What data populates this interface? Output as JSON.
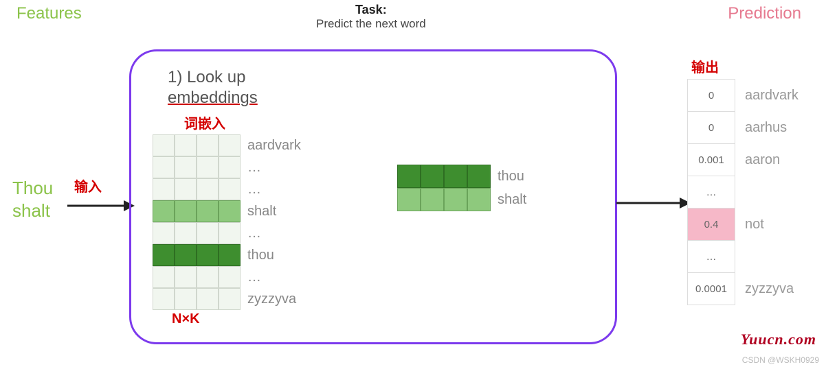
{
  "header": {
    "features": "Features",
    "task_title": "Task:",
    "task_sub": "Predict the next word",
    "prediction": "Prediction"
  },
  "input": {
    "line1": "Thou",
    "line2": "shalt",
    "anno": "输入"
  },
  "step1": {
    "line1": "1) Look up",
    "line2": "embeddings",
    "anno": "词嵌入",
    "nk": "N×K"
  },
  "emb_rows": [
    {
      "label": "aardvark",
      "style": "plain"
    },
    {
      "label": "…",
      "style": "plain"
    },
    {
      "label": "…",
      "style": "plain"
    },
    {
      "label": "shalt",
      "style": "shalt"
    },
    {
      "label": "…",
      "style": "plain"
    },
    {
      "label": "thou",
      "style": "thou"
    },
    {
      "label": "…",
      "style": "plain"
    },
    {
      "label": "zyzzyva",
      "style": "plain"
    }
  ],
  "pair": {
    "row1": {
      "label": "thou",
      "style": "thou"
    },
    "row2": {
      "label": "shalt",
      "style": "shalt"
    }
  },
  "output": {
    "anno": "输出",
    "rows": [
      {
        "value": "0",
        "label": "aardvark",
        "hi": false
      },
      {
        "value": "0",
        "label": "aarhus",
        "hi": false
      },
      {
        "value": "0.001",
        "label": "aaron",
        "hi": false
      },
      {
        "value": "…",
        "label": "",
        "hi": false
      },
      {
        "value": "0.4",
        "label": "not",
        "hi": true
      },
      {
        "value": "…",
        "label": "",
        "hi": false
      },
      {
        "value": "0.0001",
        "label": "zyzzyva",
        "hi": false
      }
    ]
  },
  "watermark": "Yuucn.com",
  "credit": "CSDN @WSKH0929"
}
